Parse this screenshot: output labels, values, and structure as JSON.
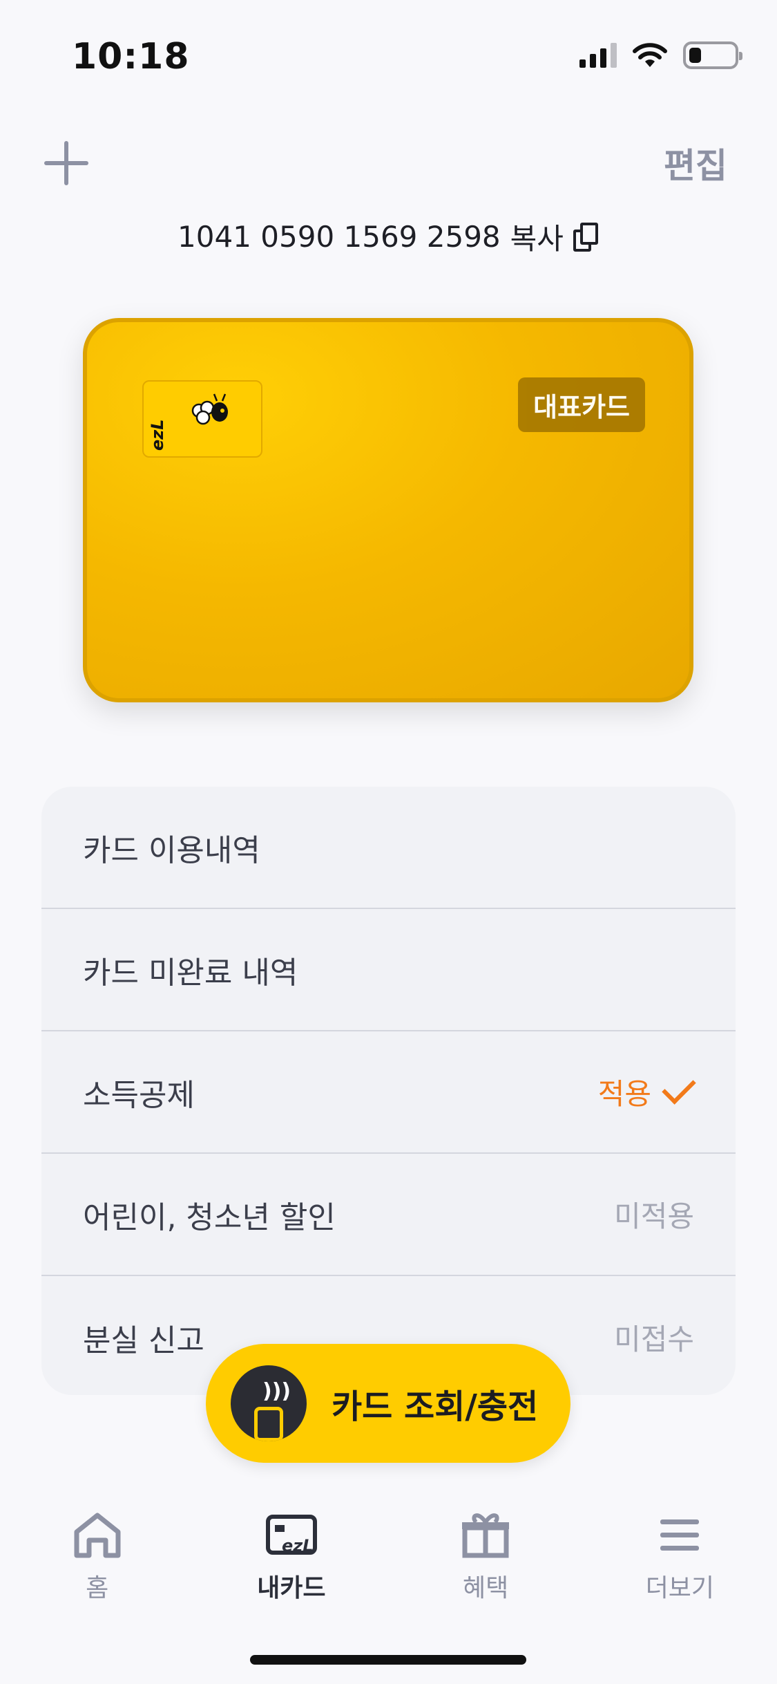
{
  "status": {
    "time": "10:18",
    "battery_level": 0.28
  },
  "header": {
    "add_icon": "plus-icon",
    "edit_label": "편집"
  },
  "card_number": {
    "number": "1041 0590 1569 2598",
    "copy_label": "복사",
    "copy_icon": "copy-icon"
  },
  "card": {
    "badge": "대표카드",
    "mini_logo": "ezL",
    "colors": {
      "primary": "#f5b800",
      "border": "#dca200",
      "badge": "#a97a00"
    }
  },
  "menu": {
    "items": [
      {
        "label": "카드 이용내역",
        "value": ""
      },
      {
        "label": "카드 미완료 내역",
        "value": ""
      },
      {
        "label": "소득공제",
        "value": "적용"
      },
      {
        "label": "어린이, 청소년 할인",
        "value": "미적용"
      },
      {
        "label": "분실 신고",
        "value": "미접수"
      }
    ],
    "accent_color": "#f27a1a"
  },
  "fab": {
    "label": "카드 조회/충전",
    "icon": "nfc-phone-icon"
  },
  "tabbar": {
    "tabs": [
      {
        "label": "홈",
        "icon": "home-icon"
      },
      {
        "label": "내카드",
        "icon": "ezl-card-icon",
        "active": true
      },
      {
        "label": "혜택",
        "icon": "gift-icon"
      },
      {
        "label": "더보기",
        "icon": "menu-icon"
      }
    ]
  }
}
